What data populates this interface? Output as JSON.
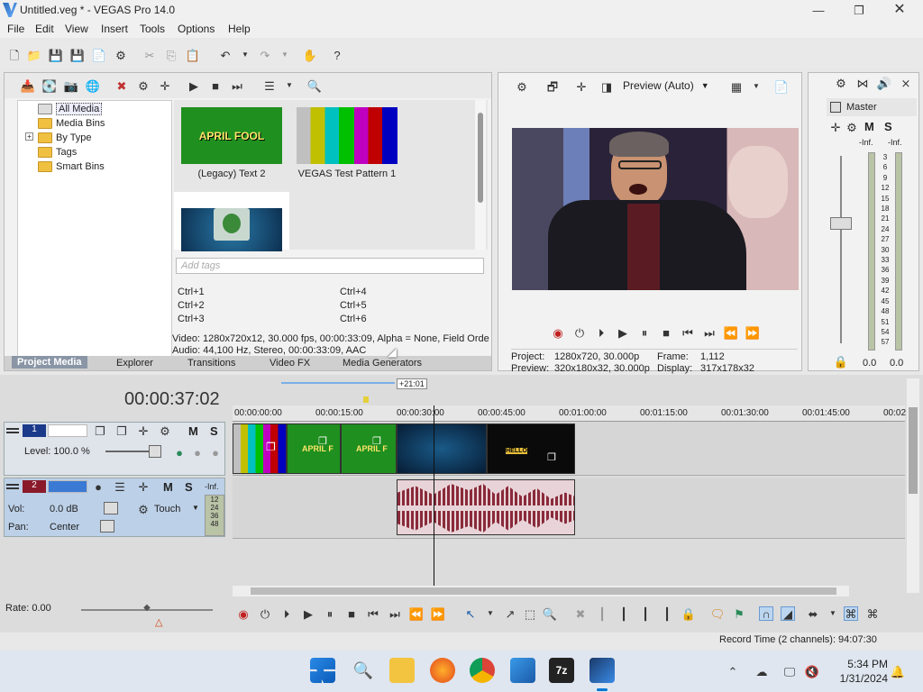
{
  "window": {
    "title": "Untitled.veg * - VEGAS Pro 14.0"
  },
  "menu": [
    "File",
    "Edit",
    "View",
    "Insert",
    "Tools",
    "Options",
    "Help"
  ],
  "media_tree": {
    "items": [
      {
        "label": "All Media",
        "selected": true
      },
      {
        "label": "Media Bins"
      },
      {
        "label": "By Type",
        "expander": "+"
      },
      {
        "label": "Tags"
      },
      {
        "label": "Smart Bins"
      }
    ]
  },
  "media_thumbs": [
    {
      "label": "(Legacy) Text 2",
      "content": "APRIL FOOL"
    },
    {
      "label": "VEGAS Test Pattern 1"
    },
    {
      "label": ""
    }
  ],
  "tags": {
    "placeholder": "Add tags",
    "shortcuts": [
      "Ctrl+1",
      "Ctrl+4",
      "Ctrl+2",
      "Ctrl+5",
      "Ctrl+3",
      "Ctrl+6"
    ]
  },
  "media_info": {
    "video": "Video: 1280x720x12, 30.000 fps, 00:00:33:09, Alpha = None, Field Orde",
    "audio": "Audio: 44,100 Hz, Stereo, 00:00:33:09, AAC"
  },
  "left_tabs": [
    "Project Media",
    "Explorer",
    "Transitions",
    "Video FX",
    "Media Generators"
  ],
  "preview": {
    "mode": "Preview (Auto)",
    "project_label": "Project:",
    "project_value": "1280x720, 30.000p",
    "preview_label": "Preview:",
    "preview_value": "320x180x32, 30.000p",
    "frame_label": "Frame:",
    "frame_value": "1,112",
    "display_label": "Display:",
    "display_value": "317x178x32"
  },
  "master": {
    "title": "Master",
    "m": "M",
    "s": "S",
    "inf_left": "-Inf.",
    "inf_right": "-Inf.",
    "scale": [
      "3",
      "6",
      "9",
      "12",
      "15",
      "18",
      "21",
      "24",
      "27",
      "30",
      "33",
      "36",
      "39",
      "42",
      "45",
      "48",
      "51",
      "54",
      "57"
    ],
    "bottom_left": "0.0",
    "bottom_right": "0.0"
  },
  "timeline": {
    "timecode": "00:00:37:02",
    "offset_label": "+21:01",
    "ruler": [
      "00:00:00:00",
      "00:00:15:00",
      "00:00:30:00",
      "00:00:45:00",
      "00:01:00:00",
      "00:01:15:00",
      "00:01:30:00",
      "00:01:45:00",
      "00:02"
    ],
    "track1": {
      "num": "1",
      "level_label": "Level: 100.0 %",
      "m": "M",
      "s": "S"
    },
    "track2": {
      "num": "2",
      "vol_label": "Vol:",
      "vol_value": "0.0 dB",
      "pan_label": "Pan:",
      "pan_value": "Center",
      "mode": "Touch",
      "m": "M",
      "s": "S",
      "meter_top": "-Inf.",
      "meter_scale": [
        "12",
        "24",
        "36",
        "48"
      ]
    },
    "clip_text": [
      "APRIL F",
      "APRIL F"
    ],
    "thumb_text": "HELLO"
  },
  "status": {
    "rate": "Rate: 0.00",
    "record_time": "Record Time (2 channels): 94:07:30"
  },
  "taskbar": {
    "time": "5:34 PM",
    "date": "1/31/2024",
    "apps": [
      "windows-start",
      "search",
      "file-explorer",
      "firefox",
      "chrome",
      "photos",
      "7zip",
      "vegas"
    ]
  },
  "colors": {
    "accent": "#0078d4",
    "track_video": "#1a8a1a",
    "audio_clip": "#8a2a3a"
  }
}
